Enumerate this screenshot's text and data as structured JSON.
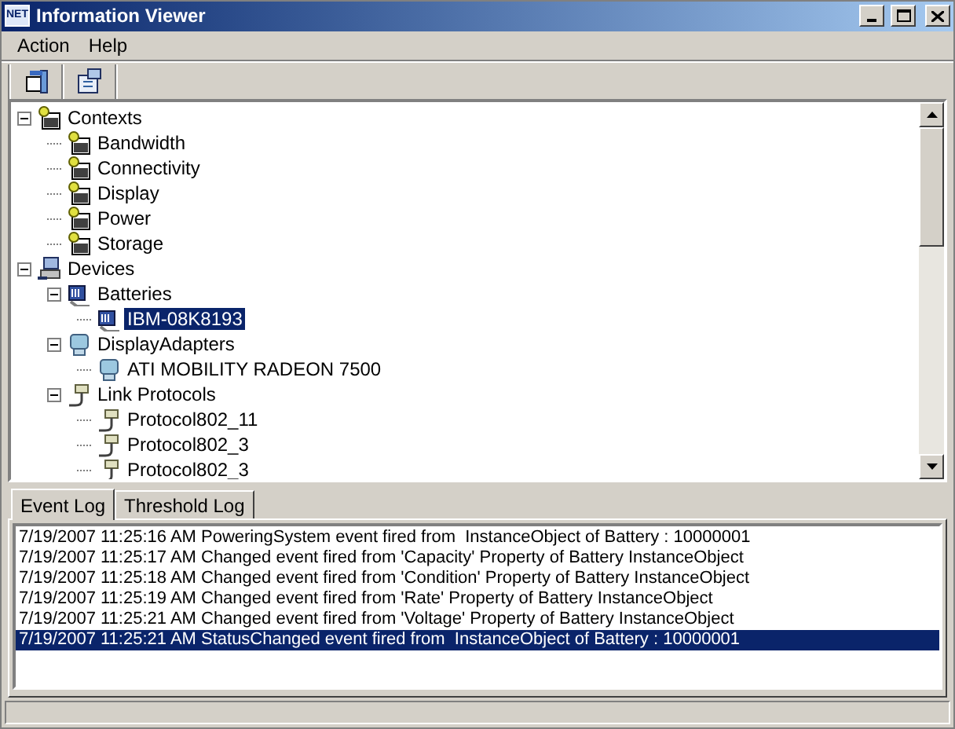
{
  "window": {
    "title": "Information Viewer",
    "app_icon": "NET"
  },
  "menu": [
    "Action",
    "Help"
  ],
  "tree": [
    {
      "label": "Contexts",
      "kind": "context",
      "expanded": true,
      "selected": false,
      "children": [
        {
          "label": "Bandwidth",
          "kind": "context",
          "selected": false
        },
        {
          "label": "Connectivity",
          "kind": "context",
          "selected": false
        },
        {
          "label": "Display",
          "kind": "context",
          "selected": false
        },
        {
          "label": "Power",
          "kind": "context",
          "selected": false
        },
        {
          "label": "Storage",
          "kind": "context",
          "selected": false
        }
      ]
    },
    {
      "label": "Devices",
      "kind": "devices",
      "expanded": true,
      "selected": false,
      "children": [
        {
          "label": "Batteries",
          "kind": "battery",
          "expanded": true,
          "selected": false,
          "children": [
            {
              "label": "IBM-08K8193",
              "kind": "battery",
              "selected": true
            }
          ]
        },
        {
          "label": "DisplayAdapters",
          "kind": "display",
          "expanded": true,
          "selected": false,
          "children": [
            {
              "label": "ATI MOBILITY RADEON 7500",
              "kind": "display",
              "selected": false
            }
          ]
        },
        {
          "label": "Link Protocols",
          "kind": "protocol",
          "expanded": true,
          "selected": false,
          "children": [
            {
              "label": "Protocol802_11",
              "kind": "protocol",
              "selected": false
            },
            {
              "label": "Protocol802_3",
              "kind": "protocol",
              "selected": false
            },
            {
              "label": "Protocol802_3",
              "kind": "protocol",
              "selected": false
            }
          ]
        }
      ]
    }
  ],
  "tabs": [
    {
      "label": "Event Log",
      "selected": true
    },
    {
      "label": "Threshold Log",
      "selected": false
    }
  ],
  "log": [
    {
      "text": "7/19/2007 11:25:16 AM PoweringSystem event fired from  InstanceObject of Battery : 10000001",
      "selected": false
    },
    {
      "text": "7/19/2007 11:25:17 AM Changed event fired from 'Capacity' Property of Battery InstanceObject",
      "selected": false
    },
    {
      "text": "7/19/2007 11:25:18 AM Changed event fired from 'Condition' Property of Battery InstanceObject",
      "selected": false
    },
    {
      "text": "7/19/2007 11:25:19 AM Changed event fired from 'Rate' Property of Battery InstanceObject",
      "selected": false
    },
    {
      "text": "7/19/2007 11:25:21 AM Changed event fired from 'Voltage' Property of Battery InstanceObject",
      "selected": false
    },
    {
      "text": "7/19/2007 11:25:21 AM StatusChanged event fired from  InstanceObject of Battery : 10000001",
      "selected": true
    }
  ]
}
